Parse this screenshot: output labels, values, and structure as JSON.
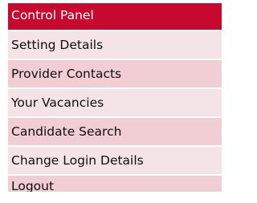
{
  "menu": {
    "items": [
      {
        "label": "Control Panel",
        "active": true
      },
      {
        "label": "Setting Details"
      },
      {
        "label": "Provider Contacts"
      },
      {
        "label": "Your Vacancies"
      },
      {
        "label": "Candidate Search"
      },
      {
        "label": "Change Login Details"
      },
      {
        "label": "Logout"
      }
    ]
  },
  "colors": {
    "active_background": "#c8092f",
    "active_text": "#ffffff",
    "row_light": "#f4e4e7",
    "row_dark": "#f1ced3",
    "text": "#0f0f0f"
  }
}
